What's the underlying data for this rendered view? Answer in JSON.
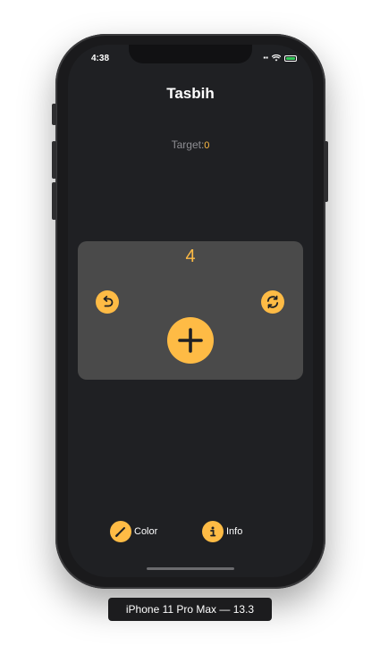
{
  "status_bar": {
    "time": "4:38",
    "wifi_icon": "wifi-icon",
    "battery_icon": "battery-charging-icon"
  },
  "app": {
    "title": "Tasbih",
    "target_label": "Target:",
    "target_value": "0",
    "count": "4"
  },
  "controls": {
    "undo_icon": "undo-arrow-icon",
    "reset_icon": "refresh-icon",
    "increment_icon": "plus-icon"
  },
  "bottom_bar": {
    "items": [
      {
        "label": "Color",
        "icon": "pencil-icon"
      },
      {
        "label": "Info",
        "icon": "info-icon"
      }
    ]
  },
  "device_label": "iPhone 11 Pro Max — 13.3",
  "colors": {
    "accent": "#febb45",
    "background": "#1f2023",
    "card": "#4a4a4a"
  }
}
